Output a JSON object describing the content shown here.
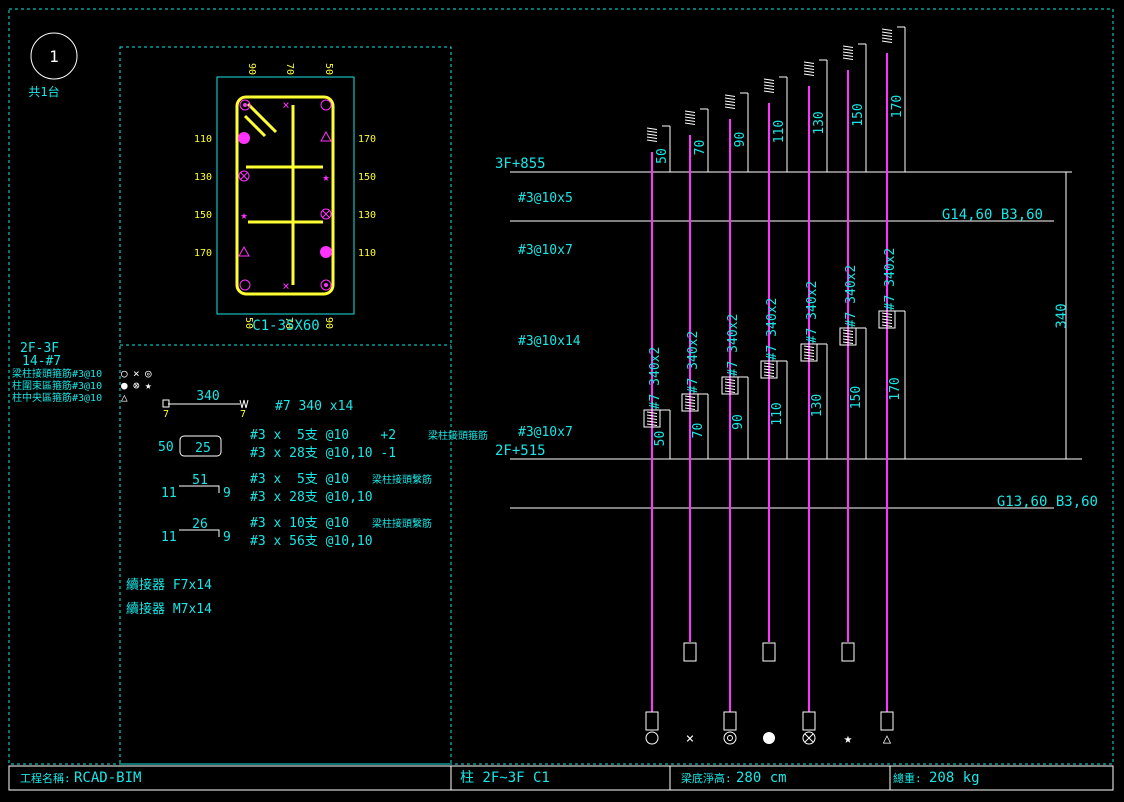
{
  "sheet": {
    "number": "1",
    "count": "共1台"
  },
  "section": {
    "top_dims": [
      "90",
      "70",
      "50"
    ],
    "left_dims": [
      "110",
      "130",
      "150",
      "170"
    ],
    "right_dims": [
      "170",
      "150",
      "130",
      "110"
    ],
    "label": "C1-35X60",
    "bottom_marks": [
      "50",
      "70",
      "90"
    ]
  },
  "legend": {
    "floor_range": "2F-3F",
    "main_bar": "14-#7",
    "rows": [
      {
        "label": "梁柱接頭箍筋#3@10",
        "symbols": [
          "○",
          "×",
          "◎"
        ]
      },
      {
        "label": "柱圍束區箍筋#3@10",
        "symbols": [
          "●",
          "⊗",
          "★"
        ]
      },
      {
        "label": "柱中央區箍筋#3@10",
        "symbols": [
          "△"
        ]
      }
    ]
  },
  "schedule": {
    "main_bar_len": "340",
    "hook_left": "7",
    "hook_right": "7",
    "main_bar_text": "#7 340 x14",
    "tie1_side": "50",
    "tie1_len": "25",
    "tie1_line1": "#3 x  5支 @10    +2",
    "tie1_line1_note": "梁柱接頭箍筋",
    "tie1_line2": "#3 x 28支 @10,10 -1",
    "tie2_len": "51",
    "tie2_left": "11",
    "tie2_right": "9",
    "tie2_line1": "#3 x  5支 @10",
    "tie2_line1_note": "梁柱接頭繫筋",
    "tie2_line2": "#3 x 28支 @10,10",
    "tie3_len": "26",
    "tie3_left": "11",
    "tie3_right": "9",
    "tie3_line1": "#3 x 10支 @10",
    "tie3_line1_note": "梁柱接頭繫筋",
    "tie3_line2": "#3 x 56支 @10,10",
    "coupler1": "續接器 F7x14",
    "coupler2": "續接器 M7x14"
  },
  "elevation": {
    "top_level": "3F+855",
    "bottom_level": "2F+515",
    "beam_top": "G14,60 B3,60",
    "beam_bottom": "G13,60 B3,60",
    "height": "340",
    "ties": [
      "#3@10x5",
      "#3@10x7",
      "#3@10x14",
      "#3@10x7"
    ],
    "splice_top": [
      "50",
      "70",
      "90",
      "110",
      "130",
      "150",
      "170"
    ],
    "bar_labels": [
      "#7 340x2",
      "#7 340x2",
      "#7 340x2",
      "#7 340x2",
      "#7 340x2",
      "#7 340x2",
      "#7 340x2"
    ],
    "splice_bottom": [
      "50",
      "70",
      "90",
      "110",
      "130",
      "150",
      "170"
    ],
    "symbols": [
      "○",
      "×",
      "◎",
      "●",
      "⊗",
      "★",
      "△"
    ]
  },
  "footer": {
    "project_label": "工程名稱:",
    "project_name": "RCAD-BIM",
    "member": "柱 2F~3F C1",
    "beam_depth_label": "梁底淨高:",
    "beam_depth": "280 cm",
    "weight_label": "總重:",
    "weight": "208 kg"
  },
  "colors": {
    "text": "#19e6e6",
    "rebar": "#ffff33",
    "longitudinal": "#ff33ff",
    "line": "#ffffff"
  }
}
